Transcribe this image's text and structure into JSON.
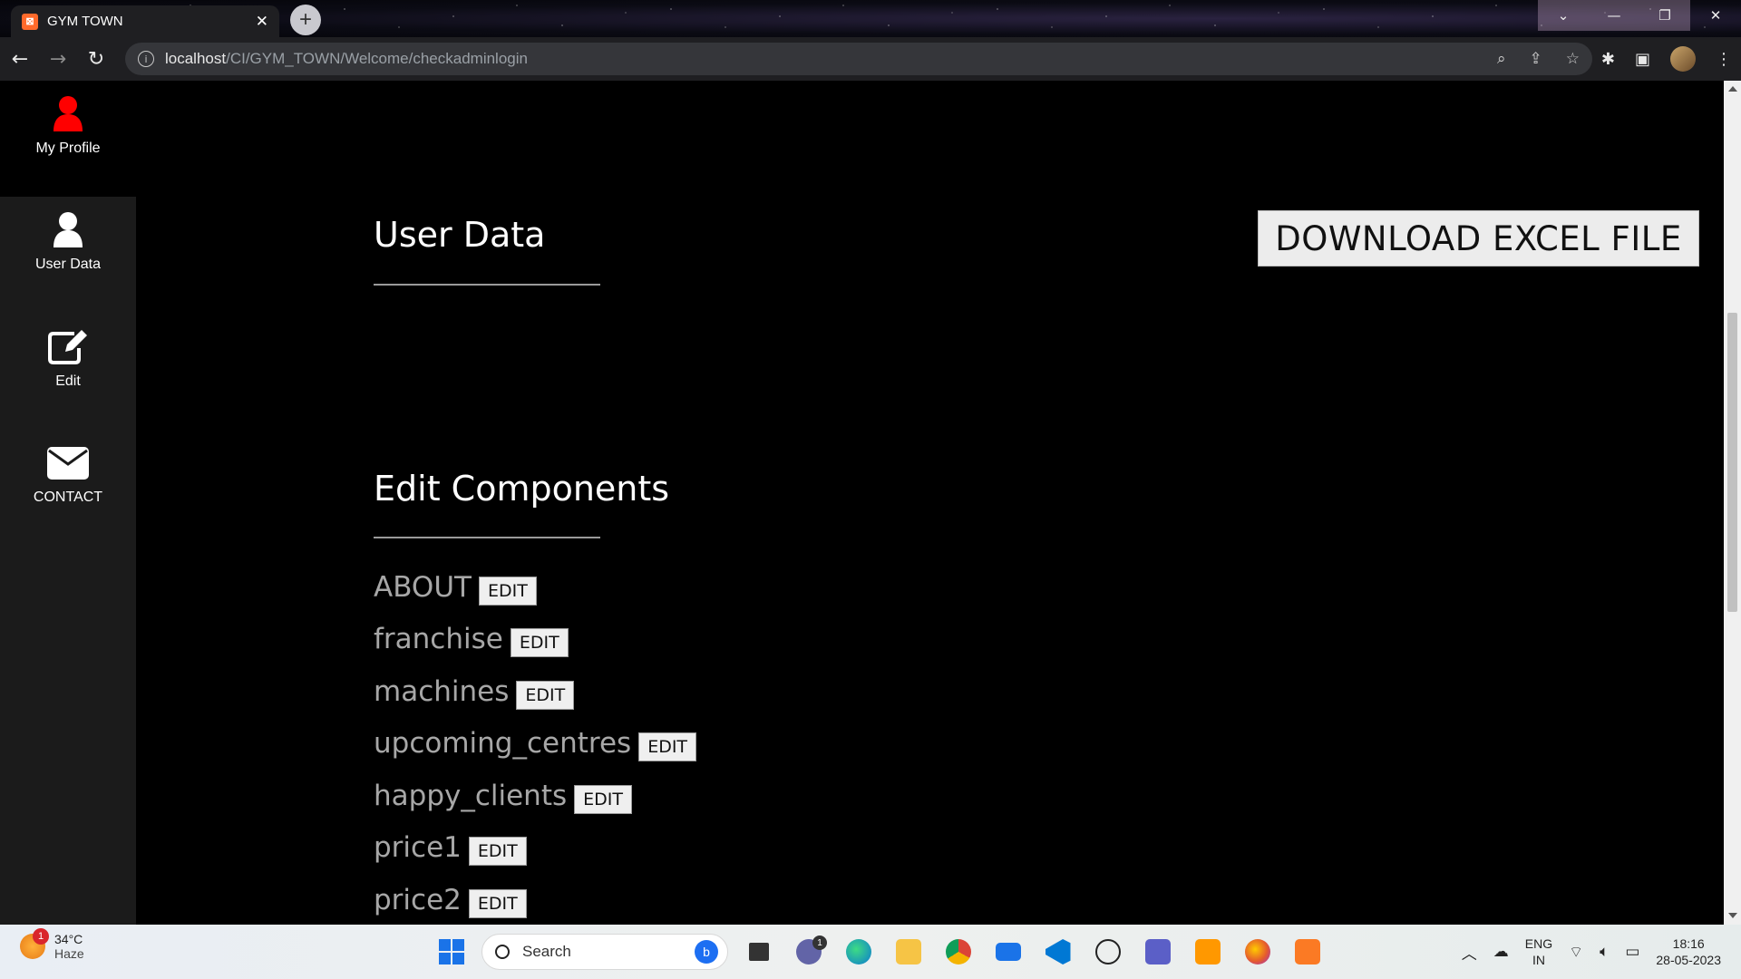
{
  "browser": {
    "tab_title": "GYM TOWN",
    "tab_close": "✕",
    "new_tab": "+",
    "url_host": "localhost",
    "url_path": "/CI/GYM_TOWN/Welcome/checkadminlogin",
    "window_controls": [
      "⌄",
      "—",
      "❐",
      "✕"
    ]
  },
  "sidebar": {
    "items": [
      {
        "label": "My Profile",
        "icon": "user-icon",
        "color": "#ff0000"
      },
      {
        "label": "User Data",
        "icon": "user-icon",
        "color": "#ffffff"
      },
      {
        "label": "Edit",
        "icon": "edit-icon",
        "color": "#ffffff"
      },
      {
        "label": "CONTACT",
        "icon": "envelope-icon",
        "color": "#ffffff"
      }
    ]
  },
  "main": {
    "user_data_title": "User Data",
    "download_button": "DOWNLOAD EXCEL FILE",
    "edit_components_title": "Edit Components",
    "components": [
      {
        "name": "ABOUT",
        "button": "EDIT"
      },
      {
        "name": "franchise",
        "button": "EDIT"
      },
      {
        "name": "machines",
        "button": "EDIT"
      },
      {
        "name": "upcoming_centres",
        "button": "EDIT"
      },
      {
        "name": "happy_clients",
        "button": "EDIT"
      },
      {
        "name": "price1",
        "button": "EDIT"
      },
      {
        "name": "price2",
        "button": "EDIT"
      }
    ]
  },
  "taskbar": {
    "weather_temp": "34°C",
    "weather_desc": "Haze",
    "weather_badge": "1",
    "search_label": "Search",
    "chat_badge": "1",
    "lang_line1": "ENG",
    "lang_line2": "IN",
    "time": "18:16",
    "date": "28-05-2023"
  }
}
